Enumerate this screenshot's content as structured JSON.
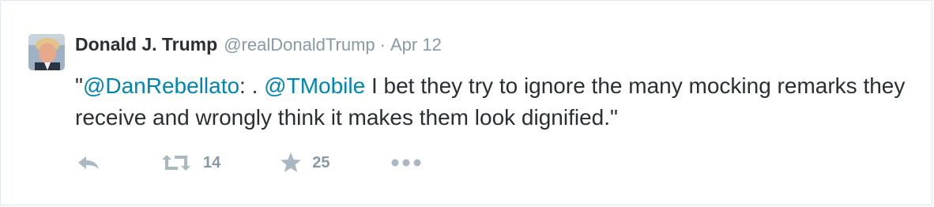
{
  "tweet": {
    "author_name": "Donald J. Trump",
    "handle": "@realDonaldTrump",
    "separator": "·",
    "timestamp": "Apr 12",
    "text_parts": {
      "open_quote": "\"",
      "mention1": "@DanRebellato",
      "mid": ": . ",
      "mention2": "@TMobile",
      "body": " I bet they try to ignore the many mocking remarks they receive and wrongly think it makes them look dignified.\""
    },
    "retweet_count": "14",
    "favorite_count": "25"
  },
  "icons": {
    "avatar": "profile-photo",
    "reply": "reply-icon",
    "retweet": "retweet-icon",
    "favorite": "star-icon",
    "more": "more-dots-icon"
  },
  "colors": {
    "mention": "#0084b4",
    "muted": "#8899a6",
    "icon": "#aab8c2",
    "text": "#292f33"
  }
}
